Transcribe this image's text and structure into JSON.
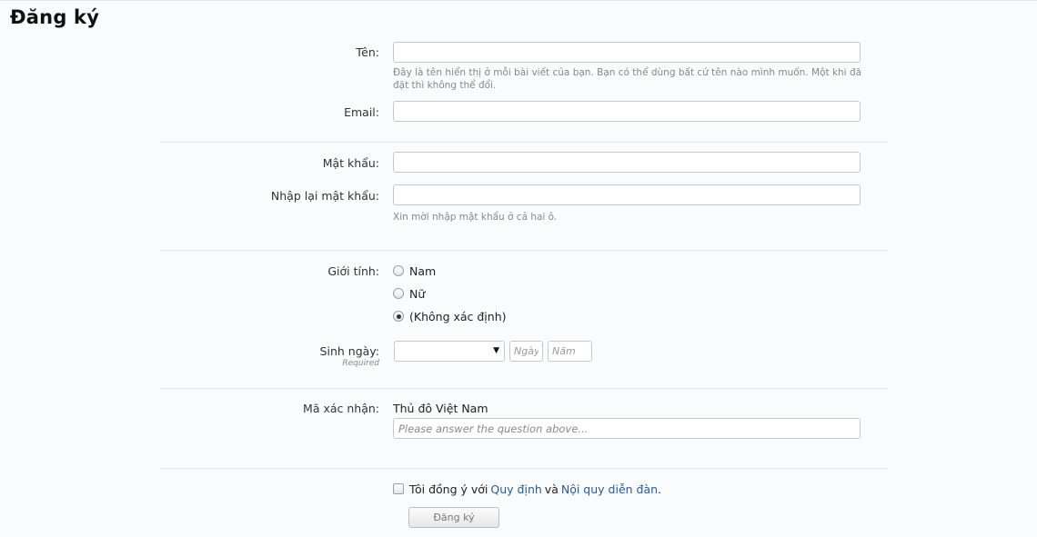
{
  "page": {
    "title": "Đăng ký"
  },
  "form": {
    "name": {
      "label": "Tên:",
      "value": "",
      "hint": "Đây là tên hiển thị ở mỗi bài viết của bạn. Bạn có thể dùng bất cứ tên nào mình muốn. Một khi đã đặt thì không thể đổi."
    },
    "email": {
      "label": "Email:",
      "value": ""
    },
    "password": {
      "label": "Mật khẩu:",
      "value": ""
    },
    "password_confirm": {
      "label": "Nhập lại mật khẩu:",
      "value": "",
      "hint": "Xin mời nhập mật khẩu ở cả hai ô."
    },
    "gender": {
      "label": "Giới tính:",
      "options": [
        {
          "label": "Nam",
          "checked": false
        },
        {
          "label": "Nữ",
          "checked": false
        },
        {
          "label": "(Không xác định)",
          "checked": true
        }
      ]
    },
    "birthday": {
      "label": "Sinh ngày:",
      "sublabel": "Required",
      "month_value": "",
      "day_placeholder": "Ngày",
      "year_placeholder": "Năm"
    },
    "captcha": {
      "label": "Mã xác nhận:",
      "question": "Thủ đô Việt Nam",
      "placeholder": "Please answer the question above..."
    },
    "agree": {
      "prefix": "Tôi đồng ý với",
      "link1": "Quy định",
      "conj": "và",
      "link2": "Nội quy diễn đàn",
      "suffix": ".",
      "checked": false
    },
    "submit_label": "Đăng ký"
  },
  "colors": {
    "link": "#2a5a9b",
    "divider": "#dfe7ee",
    "background": "#fafbfd"
  }
}
